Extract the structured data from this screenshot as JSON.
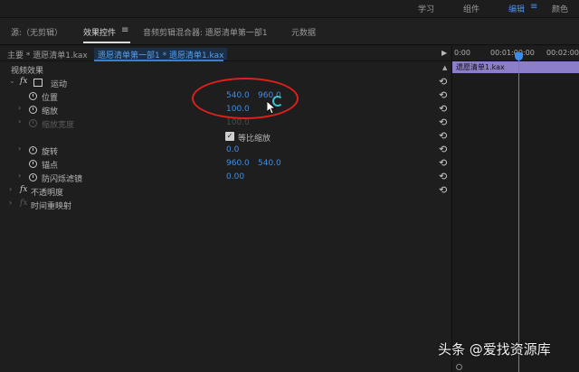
{
  "workspaces": {
    "items": [
      {
        "label": "学习",
        "active": false
      },
      {
        "label": "组件",
        "active": false
      },
      {
        "label": "编辑",
        "active": true
      },
      {
        "label": "颜色",
        "active": false
      }
    ],
    "menu_icon": "hamburger-icon"
  },
  "tabs": [
    {
      "label": "源:（无剪辑）",
      "active": false
    },
    {
      "label": "效果控件",
      "active": true
    },
    {
      "label": "音频剪辑混合器: 遗愿清单第一部1",
      "active": false
    },
    {
      "label": "元数据",
      "active": false
    }
  ],
  "effect_controls": {
    "master_clip": "主要 * 遗愿清单1.kax",
    "sequence_clip": "遗愿清单第一部1 * 遗愿清单1.kax",
    "section_title": "视频效果",
    "motion": {
      "label": "运动",
      "properties": [
        {
          "label": "位置",
          "values": [
            "540.0",
            "960.0"
          ],
          "enabled": true
        },
        {
          "label": "缩放",
          "values": [
            "100.0"
          ],
          "enabled": true
        },
        {
          "label": "缩放宽度",
          "values": [
            "100.0"
          ],
          "enabled": false
        },
        {
          "label": "等比缩放",
          "checked": true
        },
        {
          "label": "旋转",
          "values": [
            "0.0"
          ],
          "enabled": true
        },
        {
          "label": "锚点",
          "values": [
            "960.0",
            "540.0"
          ],
          "enabled": true
        },
        {
          "label": "防闪烁滤镜",
          "values": [
            "0.00"
          ],
          "enabled": true
        }
      ]
    },
    "opacity_label": "不透明度",
    "time_remap_label": "时间重映射"
  },
  "timeline": {
    "timecodes": [
      "0:00",
      "00:01:00:00",
      "00:02:00"
    ],
    "clip_label": "遗愿清单1.kax",
    "accent": "#3a8cf0",
    "clip_color": "#8c7ec8"
  },
  "colors": {
    "value_blue": "#3e8ee8",
    "annotation_red": "#e0201c"
  },
  "watermark": "头条 @爱找资源库"
}
